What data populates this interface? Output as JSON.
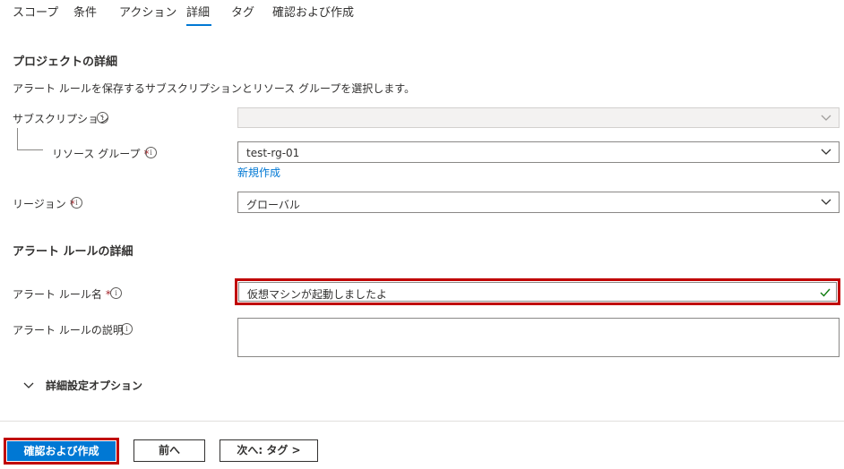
{
  "tabs": [
    {
      "label": "スコープ"
    },
    {
      "label": "条件"
    },
    {
      "label": "アクション"
    },
    {
      "label": "詳細"
    },
    {
      "label": "タグ"
    },
    {
      "label": "確認および作成"
    }
  ],
  "active_tab": "詳細",
  "project": {
    "heading": "プロジェクトの詳細",
    "description": "アラート ルールを保存するサブスクリプションとリソース グループを選択します。",
    "subscription_label": "サブスクリプション",
    "subscription_value": "",
    "resource_group_label": "リソース グループ",
    "resource_group_value": "test-rg-01",
    "create_new_link": "新規作成",
    "region_label": "リージョン",
    "region_value": "グローバル"
  },
  "rule": {
    "heading": "アラート ルールの詳細",
    "name_label": "アラート ルール名",
    "name_value": "仮想マシンが起動しましたよ",
    "description_label": "アラート ルールの説明",
    "description_value": "",
    "advanced_toggle": "詳細設定オプション"
  },
  "footer": {
    "review_create": "確認および作成",
    "previous": "前へ",
    "next": "次へ: タグ >"
  },
  "colors": {
    "accent": "#0078d4",
    "required": "#a4262c",
    "highlight": "#c00000",
    "valid": "#107c10"
  },
  "icons": [
    "info-icon",
    "chevron-down-icon",
    "checkmark-icon"
  ]
}
